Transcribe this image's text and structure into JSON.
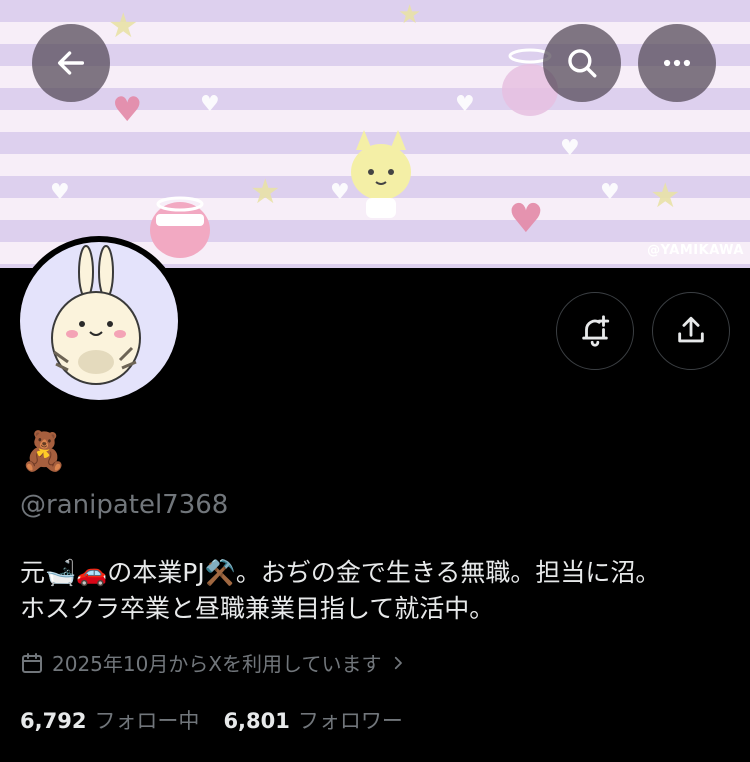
{
  "banner": {
    "watermark": "@YAMIKAWA"
  },
  "header": {
    "back_icon": "arrow-left-icon",
    "search_icon": "search-icon",
    "more_icon": "more-dots-icon"
  },
  "profile": {
    "avatar": "bunny-character-avatar",
    "display_name": "🧸",
    "handle": "@ranipatel7368",
    "bio_line1": "元🛁🚗の本業PJ⚒️。おぢの金で生きる無職。担当に沼。",
    "bio_line2": "ホスクラ卒業と昼職兼業目指して就活中。",
    "joined": "2025年10月からXを利用しています",
    "following_count": "6,792",
    "following_label": "フォロー中",
    "followers_count": "6,801",
    "followers_label": "フォロワー"
  },
  "actions": {
    "notify_icon": "bell-plus-icon",
    "share_icon": "share-icon"
  },
  "colors": {
    "background": "#000000",
    "text_primary": "#e7e9ea",
    "text_secondary": "#71767b",
    "banner_stripe_lavender": "#ddd0ee",
    "banner_stripe_pink": "#f7eef8",
    "avatar_bg": "#e4e3fb"
  }
}
